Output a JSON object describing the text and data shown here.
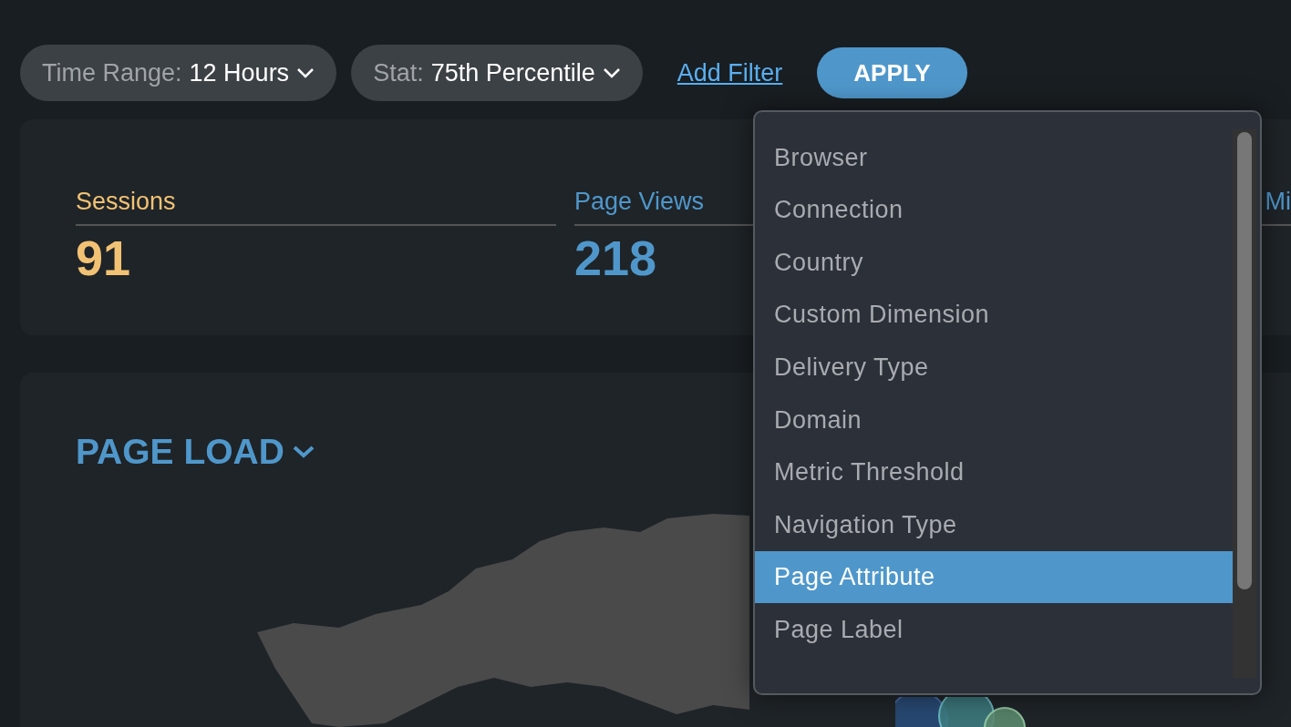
{
  "filters": [
    {
      "label": "Time Range:",
      "value": "12 Hours"
    },
    {
      "label": "Stat:",
      "value": "75th Percentile"
    }
  ],
  "add_filter": "Add Filter",
  "apply": "APPLY",
  "stats": [
    {
      "label": "Sessions",
      "value": "91",
      "color": "#f2c274"
    },
    {
      "label": "Page Views",
      "value": "218",
      "color": "#4f97cb"
    },
    {
      "label": "Mi",
      "color": "#4f97cb"
    }
  ],
  "panel": {
    "title": "PAGE LOAD"
  },
  "dropdown": {
    "items": [
      {
        "label": "Browser",
        "selected": false
      },
      {
        "label": "Connection",
        "selected": false
      },
      {
        "label": "Country",
        "selected": false
      },
      {
        "label": "Custom Dimension",
        "selected": false
      },
      {
        "label": "Delivery Type",
        "selected": false
      },
      {
        "label": "Domain",
        "selected": false
      },
      {
        "label": "Metric Threshold",
        "selected": false
      },
      {
        "label": "Navigation Type",
        "selected": false
      },
      {
        "label": "Page Attribute",
        "selected": true
      },
      {
        "label": "Page Label",
        "selected": false
      }
    ]
  }
}
